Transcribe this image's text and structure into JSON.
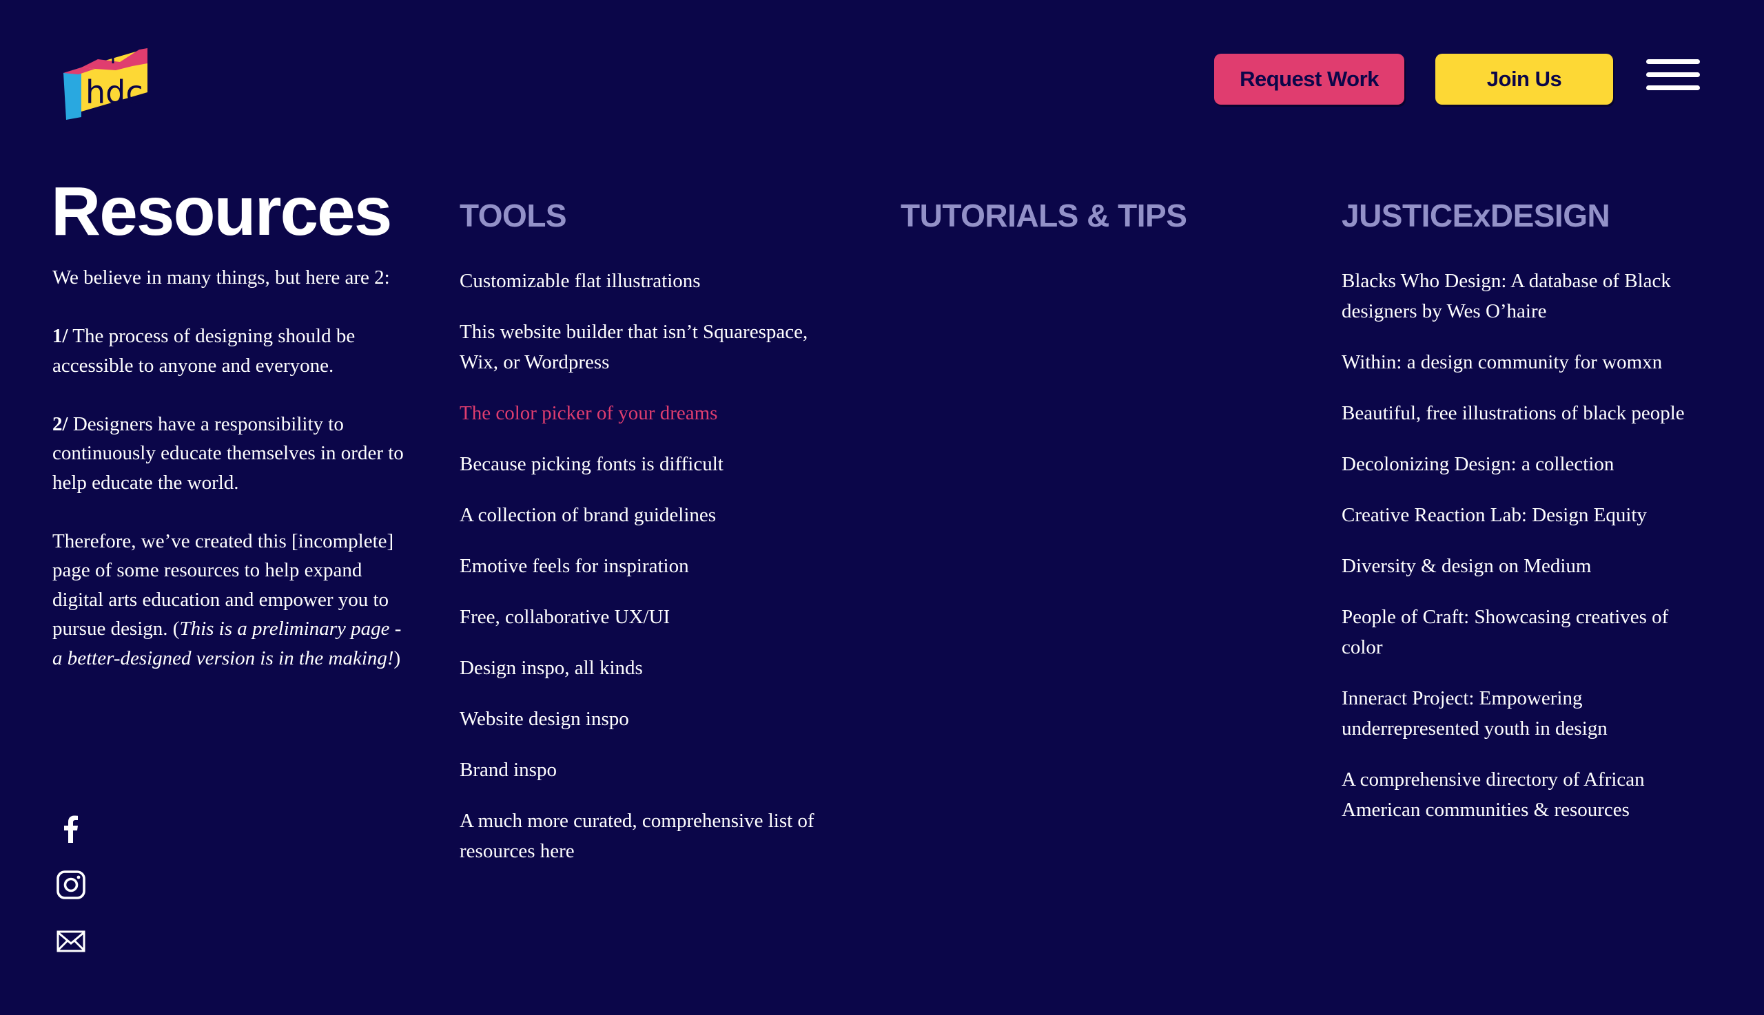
{
  "header": {
    "logo_text": "hdc",
    "request_label": "Request Work",
    "join_label": "Join Us",
    "menu_icon": "hamburger-icon"
  },
  "intro": {
    "title": "Resources",
    "p1": "We believe in many things, but here are 2:",
    "p2_num": "1/",
    "p2_text": " The process of designing should be accessible to anyone and everyone.",
    "p3_num": "2/",
    "p3_text": " Designers have a responsibility to continuously educate themselves in order to help educate the world.",
    "p4_text": "Therefore, we’ve created this [incomplete] page of some resources to help expand digital arts education and empower you to pursue design. (",
    "p4_italic": "This is a preliminary page - a better-designed version is in the making!",
    "p4_close": ")"
  },
  "social": {
    "icons": [
      "facebook-icon",
      "instagram-icon",
      "mail-icon"
    ]
  },
  "columns": {
    "tools": {
      "heading": "TOOLS",
      "items": [
        "Customizable flat illustrations",
        "This website builder that isn’t Squarespace, Wix, or Wordpress",
        "The color picker of your dreams",
        "Because picking fonts is difficult",
        "A collection of brand guidelines",
        "Emotive feels for inspiration",
        "Free, collaborative UX/UI",
        "Design inspo, all kinds",
        "Website design inspo",
        "Brand inspo",
        "A much more curated, comprehensive list of resources here"
      ]
    },
    "tutorials": {
      "heading": "TUTORIALS & TIPS"
    },
    "justice": {
      "heading": "JUSTICExDESIGN",
      "items": [
        "Blacks Who Design: A database of Black designers by Wes O’haire",
        "Within: a design community for womxn",
        "Beautiful, free illustrations of black people",
        "Decolonizing Design: a collection",
        "Creative Reaction Lab: Design Equity",
        "Diversity & design on Medium",
        "People of Craft: Showcasing creatives of color",
        "Inneract Project: Empowering underrepresented youth in design",
        "A comprehensive directory of African American communities & resources"
      ]
    }
  },
  "colors": {
    "background": "#0b0649",
    "accent_pink": "#e03d6f",
    "accent_yellow": "#fdd835",
    "heading_lavender": "#9391c8"
  }
}
